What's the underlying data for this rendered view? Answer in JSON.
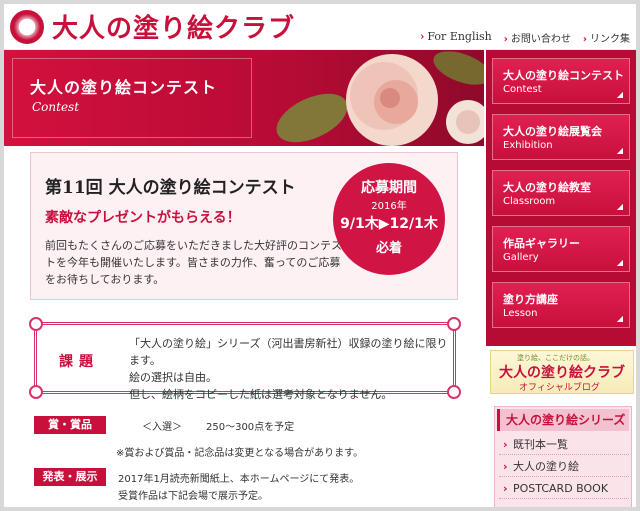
{
  "header": {
    "site_title": "大人の塗り絵クラブ",
    "links": [
      "For English",
      "お問い合わせ",
      "リンク集"
    ]
  },
  "banner": {
    "title": "大人の塗り絵コンテスト",
    "subtitle": "Contest"
  },
  "contest": {
    "title": "第11回 大人の塗り絵コンテスト",
    "catch": "素敵なプレゼントがもらえる！",
    "body": "前回もたくさんのご応募をいただきました大好評のコンテストを今年も開催いたします。皆さまの力作、奮ってのご応募をお待ちしております。",
    "period_label": "応募期間",
    "period_year": "2016年",
    "period_range": "9/1木▶12/1木",
    "period_note": "必着"
  },
  "theme": {
    "label": "課題",
    "lines": [
      "「大人の塗り絵」シリーズ（河出書房新社）収録の塗り絵に限ります。",
      "絵の選択は自由。",
      "但し、絵柄をコピーした紙は選考対象となりません。"
    ]
  },
  "awards": {
    "label": "賞・賞品",
    "category": "＜入選＞",
    "detail": "250〜300点を予定",
    "note": "※賞および賞品・記念品は変更となる場合があります。"
  },
  "announce": {
    "label": "発表・展示",
    "line1": "2017年1月読売新聞紙上、本ホームページにて発表。",
    "line2": "受賞作品は下記会場で展示予定。"
  },
  "nav": [
    {
      "jp": "大人の塗り絵コンテスト",
      "en": "Contest"
    },
    {
      "jp": "大人の塗り絵展覧会",
      "en": "Exhibition"
    },
    {
      "jp": "大人の塗り絵教室",
      "en": "Classroom"
    },
    {
      "jp": "作品ギャラリー",
      "en": "Gallery"
    },
    {
      "jp": "塗り方講座",
      "en": "Lesson"
    }
  ],
  "blog": {
    "small": "塗り絵、ここだけの話。",
    "title": "大人の塗り絵クラブ",
    "sub": "オフィシャルブログ"
  },
  "series": {
    "heading": "大人の塗り絵シリーズ",
    "items": [
      "既刊本一覧",
      "大人の塗り絵",
      "POSTCARD BOOK"
    ]
  },
  "colors": {
    "accent": "#c8103c",
    "sidebar": "#b50b35"
  }
}
